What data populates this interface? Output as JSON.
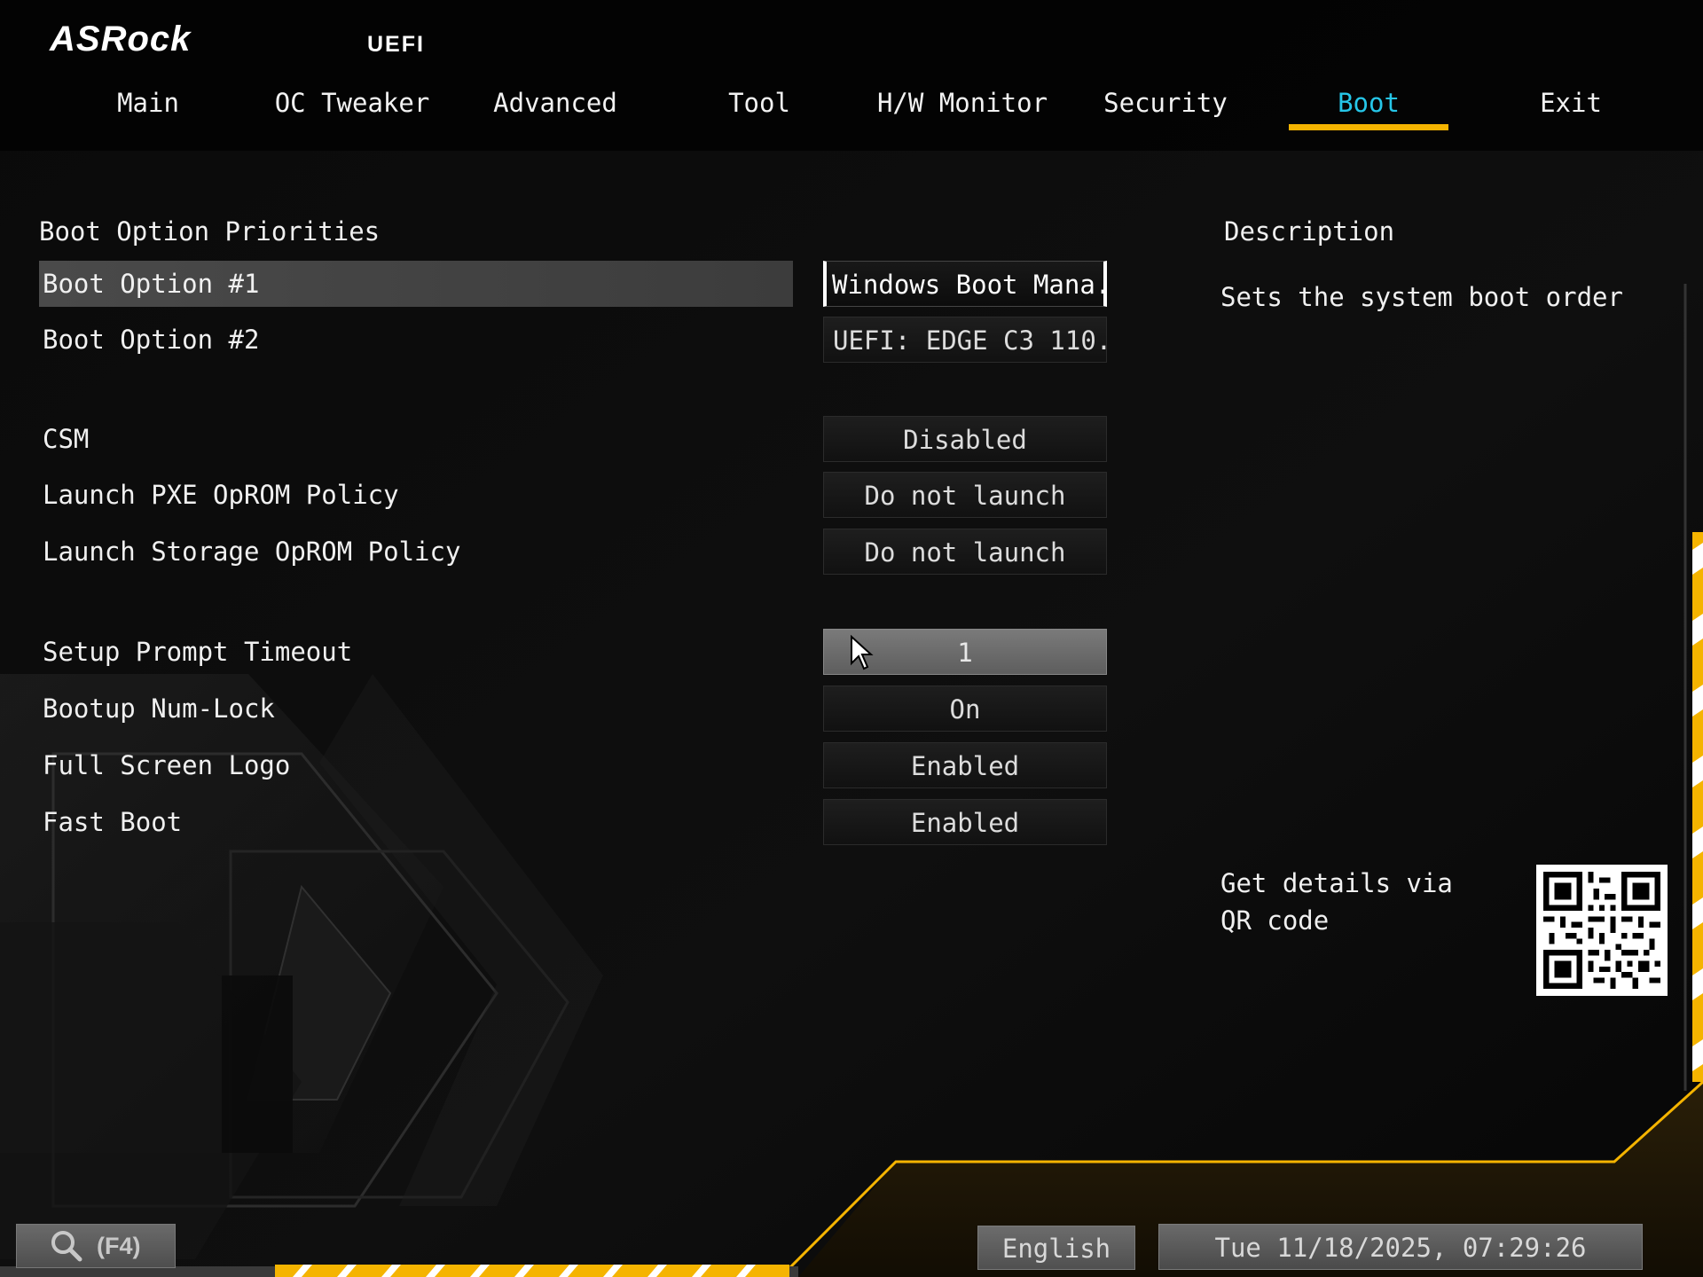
{
  "header": {
    "brand": "ASRock",
    "product": "UEFI"
  },
  "tabs": [
    {
      "label": "Main"
    },
    {
      "label": "OC Tweaker"
    },
    {
      "label": "Advanced"
    },
    {
      "label": "Tool"
    },
    {
      "label": "H/W Monitor"
    },
    {
      "label": "Security"
    },
    {
      "label": "Boot",
      "active": true
    },
    {
      "label": "Exit"
    }
  ],
  "main": {
    "section_title": "Boot Option Priorities",
    "rows": [
      {
        "label": "Boot Option #1",
        "value": "Windows Boot Mana...",
        "selected": true
      },
      {
        "label": "Boot Option #2",
        "value": "UEFI: EDGE C3 110..."
      },
      {
        "label": "CSM",
        "value": "Disabled"
      },
      {
        "label": "Launch PXE OpROM Policy",
        "value": "Do not launch"
      },
      {
        "label": "Launch Storage OpROM Policy",
        "value": "Do not launch"
      },
      {
        "label": "Setup Prompt Timeout",
        "value": "1"
      },
      {
        "label": "Bootup Num-Lock",
        "value": "On"
      },
      {
        "label": "Full Screen Logo",
        "value": "Enabled"
      },
      {
        "label": "Fast Boot",
        "value": "Enabled"
      }
    ]
  },
  "description": {
    "title": "Description",
    "text": "Sets the system boot order",
    "qr_text": "Get details via QR code"
  },
  "footer": {
    "search_key": "(F4)",
    "language": "English",
    "datetime": "Tue 11/18/2025, 07:29:26"
  },
  "colors": {
    "accent": "#f5b400",
    "active_tab": "#26c6e8",
    "background": "#050505"
  },
  "icons": {
    "search": "search-icon",
    "cursor": "mouse-pointer-icon",
    "qr": "qr-code-icon"
  }
}
